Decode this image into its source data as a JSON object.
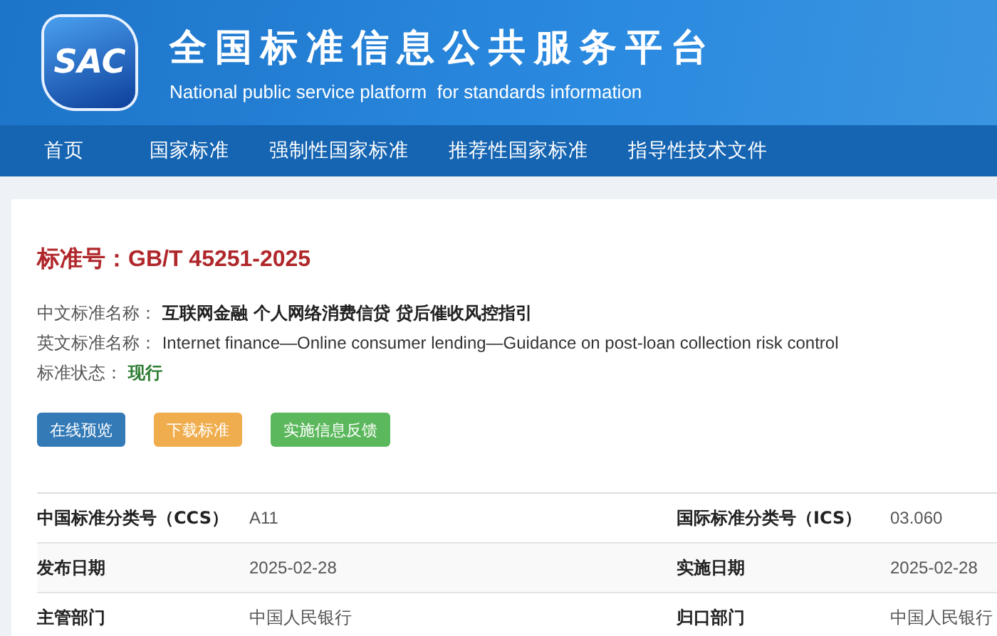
{
  "header": {
    "logo": "SAC",
    "title": "全国标准信息公共服务平台",
    "subtitle": "National public service platform  for standards information"
  },
  "nav": [
    {
      "label": "首页"
    },
    {
      "label": "国家标准"
    },
    {
      "label": "强制性国家标准"
    },
    {
      "label": "推荐性国家标准"
    },
    {
      "label": "指导性技术文件"
    }
  ],
  "standard": {
    "heading": "标准号：GB/T 45251-2025",
    "fields": [
      {
        "label": "中文标准名称：",
        "value": "互联网金融 个人网络消费信贷 贷后催收风控指引",
        "kind": "bold"
      },
      {
        "label": "英文标准名称：",
        "value": "Internet finance—Online consumer lending—Guidance on post-loan collection risk control",
        "kind": "plain"
      },
      {
        "label": "标准状态：",
        "value": "现行",
        "kind": "status"
      }
    ],
    "buttons": [
      {
        "label": "在线预览",
        "kind": "primary"
      },
      {
        "label": "下载标准",
        "kind": "warning"
      },
      {
        "label": "实施信息反馈",
        "kind": "success"
      }
    ],
    "details": [
      {
        "label": "中国标准分类号（CCS）",
        "value": "A11",
        "label_2": "国际标准分类号（ICS）",
        "value_2": "03.060"
      },
      {
        "label": "发布日期",
        "value": "2025-02-28",
        "label_2": "实施日期",
        "value_2": "2025-02-28"
      },
      {
        "label": "主管部门",
        "value": "中国人民银行",
        "label_2": "归口部门",
        "value_2": "中国人民银行"
      }
    ]
  }
}
